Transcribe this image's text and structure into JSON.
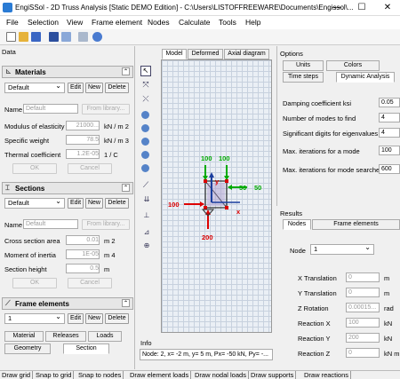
{
  "window": {
    "title": "EngiSSol - 2D Truss Analysis [Static DEMO Edition] - C:\\Users\\LISTOFFREEWARE\\Documents\\Engissol\\...",
    "min": "—",
    "max": "☐",
    "close": "✕"
  },
  "menu": [
    "File",
    "Selection",
    "View",
    "Frame element",
    "Nodes",
    "Calculate",
    "Tools",
    "Help"
  ],
  "data_label": "Data",
  "materials": {
    "header": "Materials",
    "selected": "Default",
    "edit": "Edit",
    "new": "New",
    "delete": "Delete",
    "name_label": "Name",
    "name_value": "Default",
    "library": "From library...",
    "modulus_label": "Modulus of elasticity",
    "modulus_value": "21000...",
    "modulus_unit": "kN / m 2",
    "weight_label": "Specific weight",
    "weight_value": "78.5",
    "weight_unit": "kN / m 3",
    "thermal_label": "Thermal coefficient",
    "thermal_value": "1.2E-05",
    "thermal_unit": "1 / C",
    "ok": "OK",
    "cancel": "Cancel"
  },
  "sections": {
    "header": "Sections",
    "selected": "Default",
    "edit": "Edit",
    "new": "New",
    "delete": "Delete",
    "name_label": "Name",
    "name_value": "Default",
    "library": "From library...",
    "area_label": "Cross section area",
    "area_value": "0.01",
    "area_unit": "m 2",
    "inertia_label": "Moment of inertia",
    "inertia_value": "1E-05",
    "inertia_unit": "m 4",
    "height_label": "Section height",
    "height_value": "0.5",
    "height_unit": "m",
    "ok": "OK",
    "cancel": "Cancel"
  },
  "frames": {
    "header": "Frame elements",
    "selected": "1",
    "edit": "Edit",
    "new": "New",
    "delete": "Delete",
    "tabs": [
      "Material",
      "Releases",
      "Loads",
      "Geometry",
      "Section"
    ]
  },
  "view_tabs": [
    "Model",
    "Deformed",
    "Axial diagram"
  ],
  "canvas": {
    "load_top_left": "100",
    "load_top_right": "100",
    "load_left": "100",
    "load_right": "50",
    "load_right2": "50",
    "load_bottom": "200",
    "axis_y": "y",
    "axis_x": "x"
  },
  "info": {
    "label": "Info",
    "text": "Node: 2, x= -2 m, y= 5 m, Px= -50 kN, Py= -..."
  },
  "options": {
    "label": "Options",
    "tabs": [
      "Units",
      "Colors",
      "Time steps",
      "Dynamic Analysis"
    ],
    "rows": [
      {
        "label": "Damping coefficient ksi",
        "value": "0.05"
      },
      {
        "label": "Number of modes to find",
        "value": "4"
      },
      {
        "label": "Significant digits for eigenvalues",
        "value": "4"
      },
      {
        "label": "Max. iterations for a mode",
        "value": "100"
      },
      {
        "label": "Max. iterations for mode searches",
        "value": "600"
      }
    ]
  },
  "results": {
    "label": "Results",
    "tabs": [
      "Nodes",
      "Frame elements"
    ],
    "node_label": "Node",
    "node_value": "1",
    "rows": [
      {
        "label": "X Translation",
        "value": "0",
        "unit": "m"
      },
      {
        "label": "Y Translation",
        "value": "0",
        "unit": "m"
      },
      {
        "label": "Z Rotation",
        "value": "0.00015...",
        "unit": "rad"
      },
      {
        "label": "Reaction X",
        "value": "100",
        "unit": "kN"
      },
      {
        "label": "Reaction Y",
        "value": "200",
        "unit": "kN"
      },
      {
        "label": "Reaction Z",
        "value": "0",
        "unit": "kN m"
      }
    ]
  },
  "statusbar": [
    "Draw grid",
    "Snap to grid",
    "Snap to nodes",
    "Draw element loads",
    "Draw nodal loads",
    "Draw supports",
    "Draw reactions"
  ]
}
